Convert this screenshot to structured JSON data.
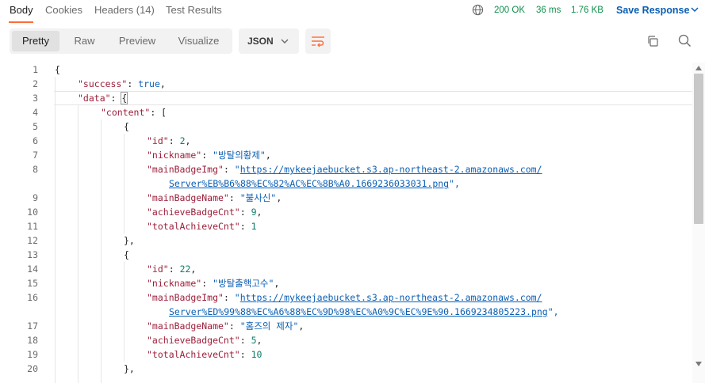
{
  "tabs": [
    {
      "label": "Body",
      "active": true
    },
    {
      "label": "Cookies",
      "active": false
    },
    {
      "label": "Headers (14)",
      "active": false
    },
    {
      "label": "Test Results",
      "active": false
    }
  ],
  "status": {
    "code": "200 OK",
    "time": "36 ms",
    "size": "1.76 KB"
  },
  "save_label": "Save Response",
  "view_modes": [
    {
      "label": "Pretty",
      "active": true
    },
    {
      "label": "Raw",
      "active": false
    },
    {
      "label": "Preview",
      "active": false
    },
    {
      "label": "Visualize",
      "active": false
    }
  ],
  "format": "JSON",
  "icons": {
    "globe": "globe-icon",
    "save_chevron": "chevron-down-icon",
    "format_chevron": "chevron-down-icon",
    "wrap": "wrap-lines-icon",
    "copy": "copy-icon",
    "search": "search-icon"
  },
  "colors": {
    "accent": "#ff6c37",
    "status_ok": "#0f8f4b",
    "link": "#0b5fb3",
    "key": "#9c1f3a",
    "number": "#0d7d6c"
  },
  "code_lines": {
    "l1": {
      "num": "1",
      "open": "{"
    },
    "l2": {
      "num": "2",
      "key": "\"success\"",
      "sep": ": ",
      "value": "true",
      "tail": ","
    },
    "l3": {
      "num": "3",
      "key": "\"data\"",
      "sep": ": ",
      "open": "{"
    },
    "l4": {
      "num": "4",
      "key": "\"content\"",
      "sep": ": ",
      "open": "["
    },
    "l5": {
      "num": "5",
      "open": "{"
    },
    "l6": {
      "num": "6",
      "key": "\"id\"",
      "sep": ": ",
      "value": "2",
      "tail": ","
    },
    "l7": {
      "num": "7",
      "key": "\"nickname\"",
      "sep": ": ",
      "value": "\"방탈의황제\"",
      "tail": ","
    },
    "l8": {
      "num": "8",
      "key": "\"mainBadgeImg\"",
      "sep": ": ",
      "quote": "\"",
      "url1": "https://mykeejaebucket.s3.ap-northeast-2.amazonaws.com/",
      "url2": "Server%EB%B6%88%EC%82%AC%EC%8B%A0.1669236033031.png",
      "tail": "\","
    },
    "l9": {
      "num": "9",
      "key": "\"mainBadgeName\"",
      "sep": ": ",
      "value": "\"불사신\"",
      "tail": ","
    },
    "l10": {
      "num": "10",
      "key": "\"achieveBadgeCnt\"",
      "sep": ": ",
      "value": "9",
      "tail": ","
    },
    "l11": {
      "num": "11",
      "key": "\"totalAchieveCnt\"",
      "sep": ": ",
      "value": "1"
    },
    "l12": {
      "num": "12",
      "close": "},"
    },
    "l13": {
      "num": "13",
      "open": "{"
    },
    "l14": {
      "num": "14",
      "key": "\"id\"",
      "sep": ": ",
      "value": "22",
      "tail": ","
    },
    "l15": {
      "num": "15",
      "key": "\"nickname\"",
      "sep": ": ",
      "value": "\"방탈출핵고수\"",
      "tail": ","
    },
    "l16": {
      "num": "16",
      "key": "\"mainBadgeImg\"",
      "sep": ": ",
      "quote": "\"",
      "url1": "https://mykeejaebucket.s3.ap-northeast-2.amazonaws.com/",
      "url2": "Server%ED%99%88%EC%A6%88%EC%9D%98%EC%A0%9C%EC%9E%90.1669234805223.png",
      "tail": "\","
    },
    "l17": {
      "num": "17",
      "key": "\"mainBadgeName\"",
      "sep": ": ",
      "value": "\"홈즈의 제자\"",
      "tail": ","
    },
    "l18": {
      "num": "18",
      "key": "\"achieveBadgeCnt\"",
      "sep": ": ",
      "value": "5",
      "tail": ","
    },
    "l19": {
      "num": "19",
      "key": "\"totalAchieveCnt\"",
      "sep": ": ",
      "value": "10"
    },
    "l20": {
      "num": "20",
      "close": "},"
    }
  }
}
